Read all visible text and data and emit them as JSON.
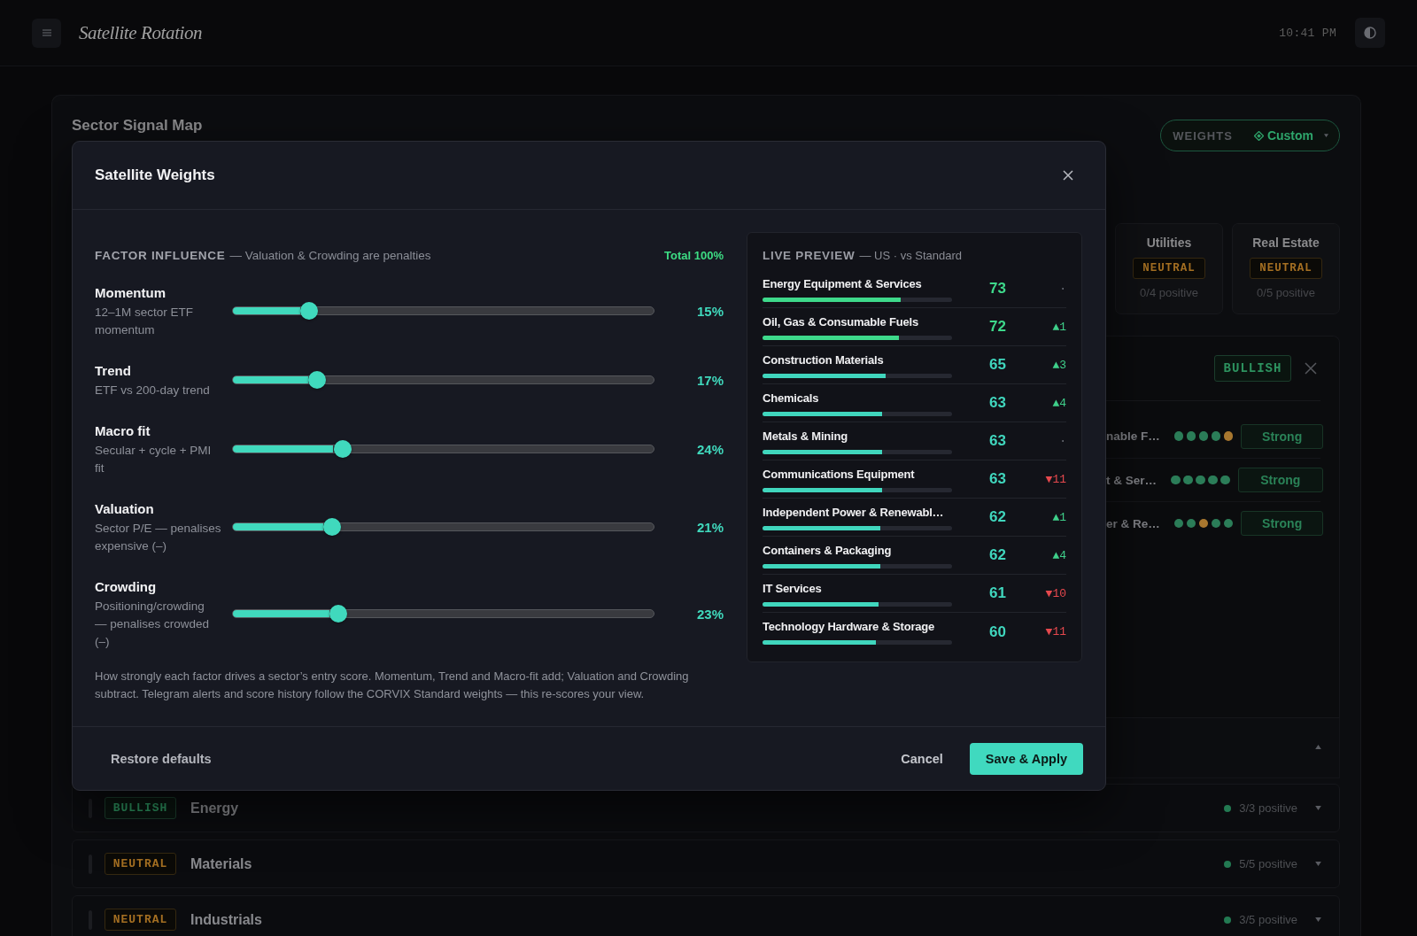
{
  "app_bar": {
    "title": "Satellite Rotation",
    "time": "10:41 PM"
  },
  "signal_map": {
    "title": "Sector Signal Map",
    "weights": {
      "label": "WEIGHTS",
      "value": "Custom"
    },
    "tiles": [
      {
        "name": "Utilities",
        "signal": "NEUTRAL",
        "kind": "neutral",
        "positive": "0/4 positive"
      },
      {
        "name": "Real Estate",
        "signal": "NEUTRAL",
        "kind": "neutral",
        "positive": "0/5 positive"
      }
    ],
    "detail": {
      "signal": "BULLISH",
      "kind": "bullish",
      "rows": [
        {
          "name": "nable F…",
          "dots": [
            {
              "color": "#2b7d58"
            },
            {
              "color": "#2b7d58"
            },
            {
              "color": "#2b7d58"
            },
            {
              "color": "#2b7d58"
            },
            {
              "color": "#a8772f"
            }
          ],
          "rating": "Strong"
        },
        {
          "name": "t & Ser…",
          "dots": [
            {
              "color": "#2b7d58"
            },
            {
              "color": "#2b7d58"
            },
            {
              "color": "#2b7d58"
            },
            {
              "color": "#2b7d58"
            },
            {
              "color": "#2b7d58"
            }
          ],
          "rating": "Strong"
        },
        {
          "name": "er & Re…",
          "dots": [
            {
              "color": "#2b7d58"
            },
            {
              "color": "#2b7d58"
            },
            {
              "color": "#a8772f"
            },
            {
              "color": "#2b7d58"
            },
            {
              "color": "#2b7d58"
            }
          ],
          "rating": "Strong"
        }
      ]
    },
    "rows": [
      {
        "expanded": true
      },
      {
        "signal": "BULLISH",
        "kind": "bullish",
        "name": "Energy",
        "positive": "3/3 positive",
        "expanded": false
      },
      {
        "signal": "NEUTRAL",
        "kind": "neutral",
        "name": "Materials",
        "positive": "5/5 positive",
        "expanded": false
      },
      {
        "signal": "NEUTRAL",
        "kind": "neutral",
        "name": "Industrials",
        "positive": "3/5 positive",
        "expanded": false
      }
    ]
  },
  "modal": {
    "title": "Satellite Weights",
    "factors": {
      "title": "FACTOR INFLUENCE",
      "subtitle": "— Valuation & Crowding are penalties",
      "total": "Total 100%",
      "items": [
        {
          "name": "Momentum",
          "description": "12–1M sector ETF momentum",
          "level": 0.18,
          "value": "15%"
        },
        {
          "name": "Trend",
          "description": "ETF vs 200-day trend",
          "level": 0.2,
          "value": "17%"
        },
        {
          "name": "Macro fit",
          "description": "Secular + cycle + PMI fit",
          "level": 0.26,
          "value": "24%"
        },
        {
          "name": "Valuation",
          "description": "Sector P/E — penalises expensive (–)",
          "level": 0.235,
          "value": "21%"
        },
        {
          "name": "Crowding",
          "description": "Positioning/crowding — penalises crowded (–)",
          "level": 0.25,
          "value": "23%"
        }
      ]
    },
    "note": "How strongly each factor drives a sector’s entry score. Momentum, Trend and Macro-fit add; Valuation and Crowding subtract. Telegram alerts and score history follow the CORVIX Standard weights — this re-scores your view.",
    "preview": {
      "title": "LIVE PREVIEW",
      "subtitle": "— US · vs Standard",
      "rows": [
        {
          "name": "Energy Equipment & Services",
          "level": 0.73,
          "score": "73",
          "color": "#3ed98b",
          "change": "·",
          "kind": "flat"
        },
        {
          "name": "Oil, Gas & Consumable Fuels",
          "level": 0.72,
          "score": "72",
          "color": "#3ed98b",
          "change": "▲1",
          "kind": "up"
        },
        {
          "name": "Construction Materials",
          "level": 0.65,
          "score": "65",
          "color": "#40d6bd",
          "change": "▲3",
          "kind": "up"
        },
        {
          "name": "Chemicals",
          "level": 0.63,
          "score": "63",
          "color": "#40d6bd",
          "change": "▲4",
          "kind": "up"
        },
        {
          "name": "Metals & Mining",
          "level": 0.63,
          "score": "63",
          "color": "#40d6bd",
          "change": "·",
          "kind": "flat"
        },
        {
          "name": "Communications Equipment",
          "level": 0.63,
          "score": "63",
          "color": "#40d6bd",
          "change": "▼11",
          "kind": "down"
        },
        {
          "name": "Independent Power & Renewabl…",
          "level": 0.62,
          "score": "62",
          "color": "#40d6bd",
          "change": "▲1",
          "kind": "up"
        },
        {
          "name": "Containers & Packaging",
          "level": 0.62,
          "score": "62",
          "color": "#40d6bd",
          "change": "▲4",
          "kind": "up"
        },
        {
          "name": "IT Services",
          "level": 0.61,
          "score": "61",
          "color": "#40d6bd",
          "change": "▼10",
          "kind": "down"
        },
        {
          "name": "Technology Hardware & Storage",
          "level": 0.6,
          "score": "60",
          "color": "#40d6bd",
          "change": "▼11",
          "kind": "down"
        }
      ]
    },
    "footer": {
      "restore": "Restore defaults",
      "cancel": "Cancel",
      "save": "Save & Apply"
    }
  }
}
